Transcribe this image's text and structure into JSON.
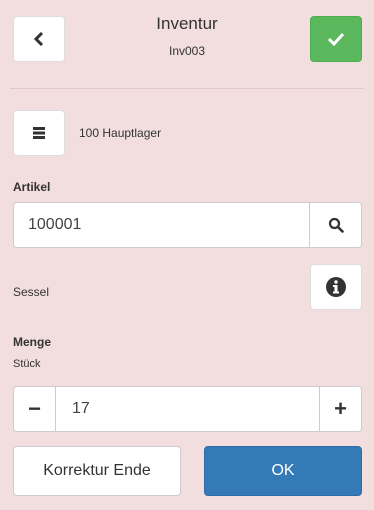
{
  "header": {
    "title": "Inventur",
    "subtitle": "Inv003"
  },
  "warehouse": {
    "label": "100 Hauptlager"
  },
  "article": {
    "label": "Artikel",
    "value": "100001",
    "name": "Sessel"
  },
  "quantity": {
    "label": "Menge",
    "unit": "Stück",
    "value": "17",
    "minus": "−",
    "plus": "+"
  },
  "actions": {
    "correction_label": "Korrektur Ende",
    "ok_label": "OK"
  },
  "icons": {
    "back": "chevron-left-icon",
    "confirm": "checkmark-icon",
    "menu": "list-icon",
    "search": "search-icon",
    "info": "info-icon"
  },
  "colors": {
    "background": "#f2dede",
    "confirm": "#5cb85c",
    "primary": "#337ab7"
  }
}
